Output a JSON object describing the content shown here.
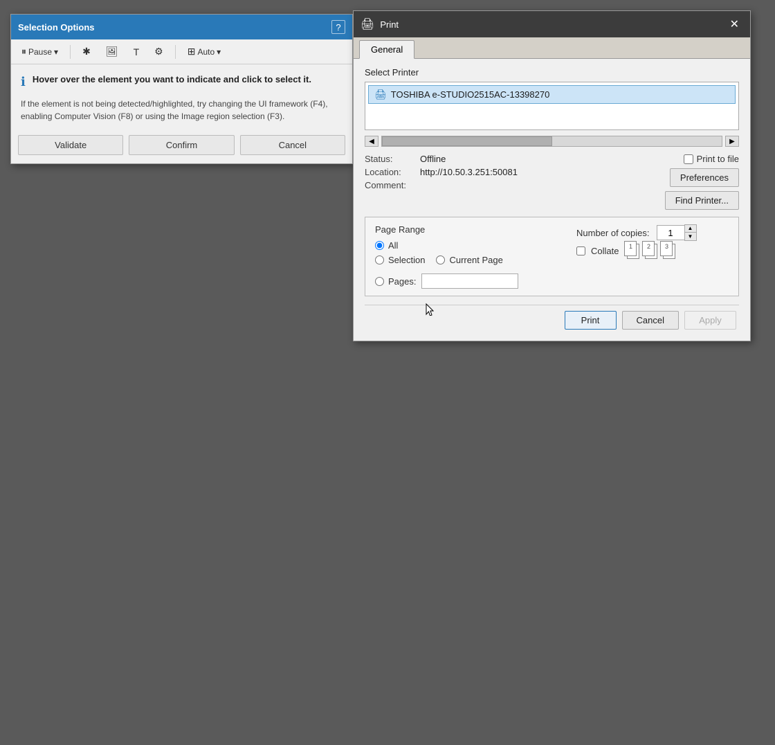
{
  "selectionDialog": {
    "title": "Selection Options",
    "helpLabel": "?",
    "toolbar": {
      "pause": "Pause",
      "auto": "Auto"
    },
    "infoHeading": "Hover over the element you want to indicate and click to select it.",
    "infoBody": "If the element is not being detected/highlighted, try changing the UI framework (F4), enabling Computer Vision (F8) or using the Image region selection (F3).",
    "buttons": {
      "validate": "Validate",
      "confirm": "Confirm",
      "cancel": "Cancel"
    }
  },
  "printDialog": {
    "title": "Print",
    "closeBtn": "✕",
    "tabs": [
      "General"
    ],
    "activeTab": "General",
    "selectPrinterLabel": "Select Printer",
    "printer": {
      "name": "TOSHIBA e-STUDIO2515AC-13398270",
      "status": "Offline",
      "statusLabel": "Status:",
      "location": "http://10.50.3.251:50081",
      "locationLabel": "Location:",
      "comment": "",
      "commentLabel": "Comment:"
    },
    "printToFile": {
      "label": "Print to file",
      "checked": false
    },
    "preferences": "Preferences",
    "findPrinter": "Find Printer...",
    "pageRange": {
      "title": "Page Range",
      "allLabel": "All",
      "selectionLabel": "Selection",
      "currentPageLabel": "Current Page",
      "pagesLabel": "Pages:",
      "allSelected": true
    },
    "copies": {
      "label": "Number of copies:",
      "value": "1"
    },
    "collate": {
      "label": "Collate",
      "checked": false
    },
    "buttons": {
      "print": "Print",
      "cancel": "Cancel",
      "apply": "Apply"
    }
  }
}
